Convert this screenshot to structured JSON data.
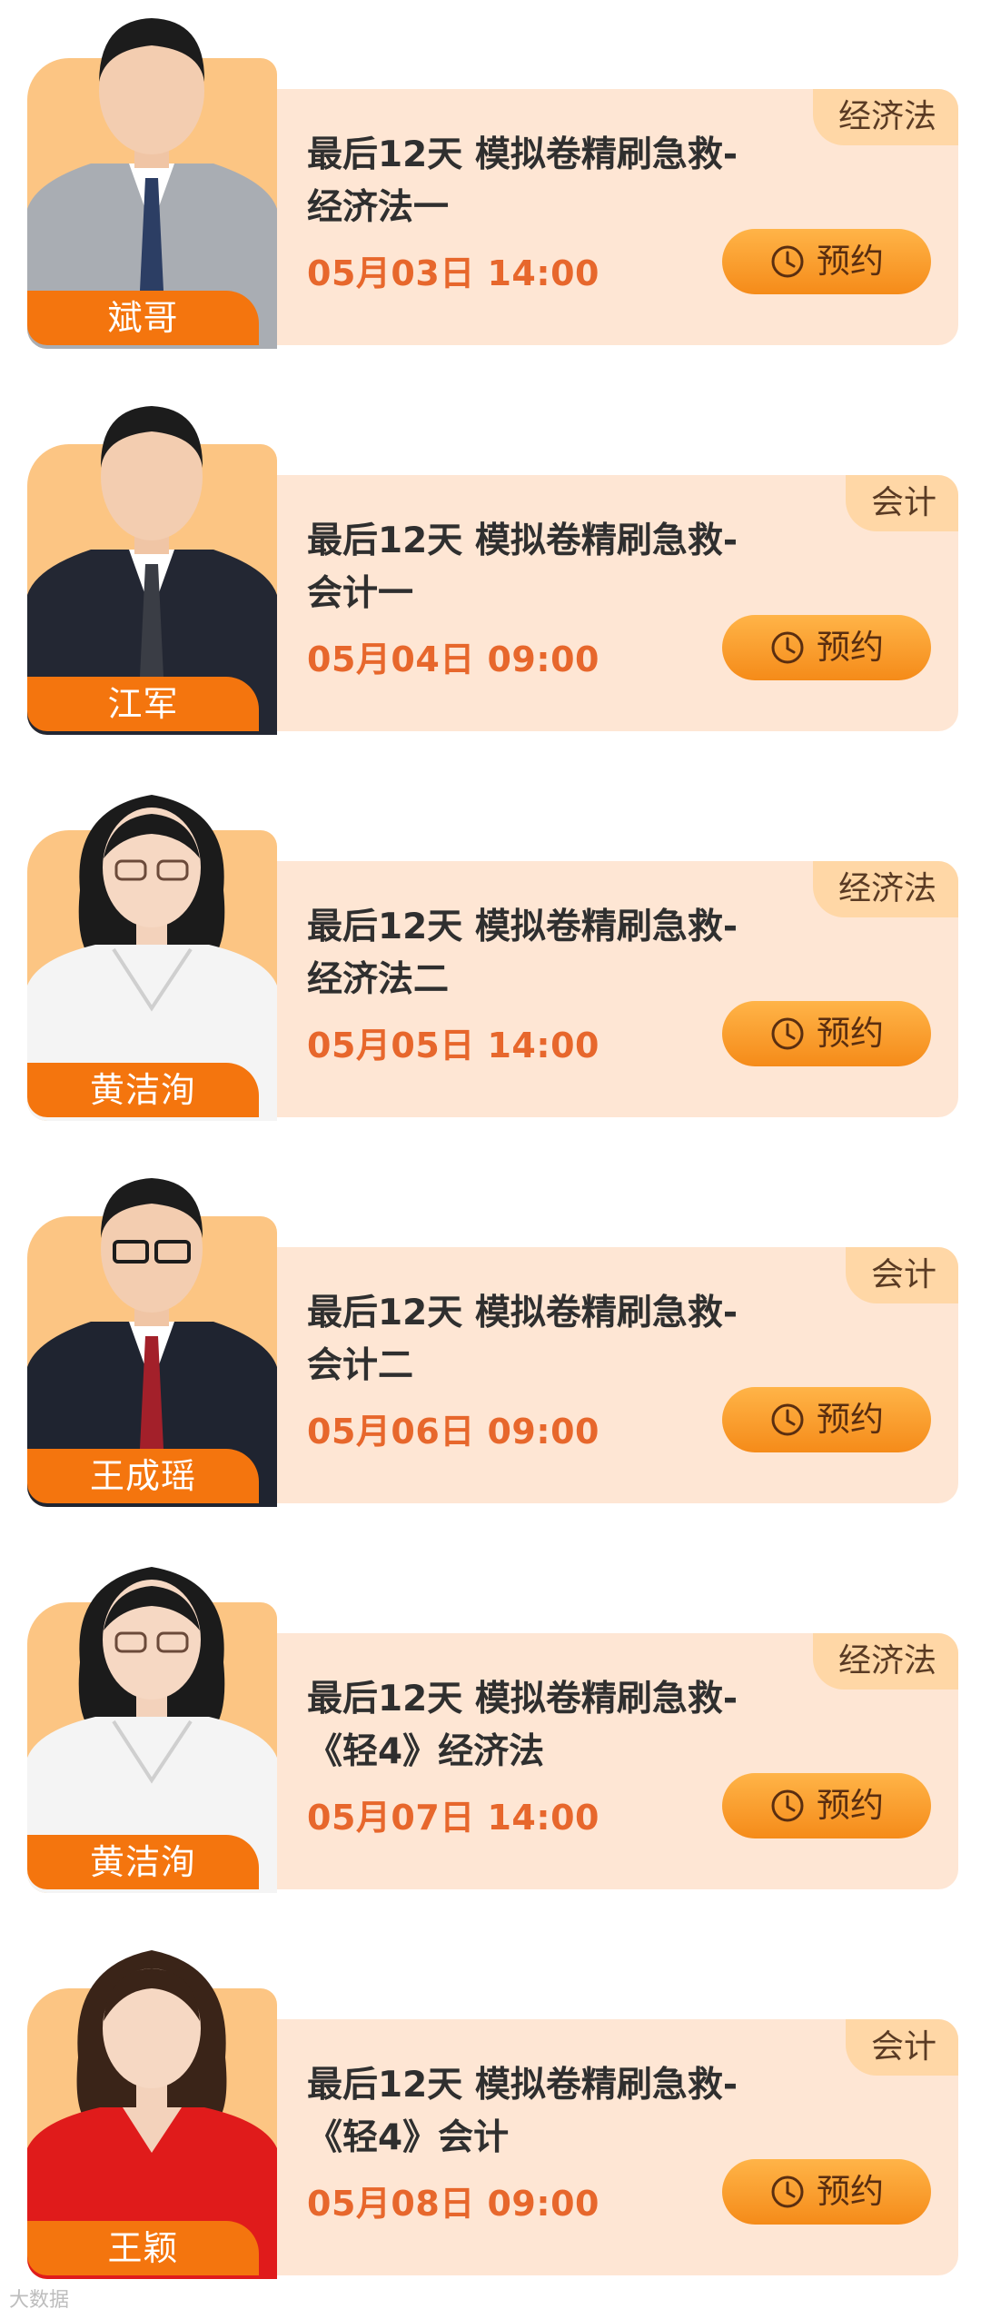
{
  "button_label": "预约",
  "cards": [
    {
      "teacher": "斌哥",
      "subject": "经济法",
      "title_line1": "最后12天 模拟卷精刷急救-",
      "title_line2": "经济法一",
      "datetime": "05月03日 14:00",
      "suit": "gray-suit"
    },
    {
      "teacher": "江军",
      "subject": "会计",
      "title_line1": "最后12天 模拟卷精刷急救-",
      "title_line2": "会计一",
      "datetime": "05月04日 09:00",
      "suit": "dark-suit"
    },
    {
      "teacher": "黄洁洵",
      "subject": "经济法",
      "title_line1": "最后12天 模拟卷精刷急救-",
      "title_line2": "经济法二",
      "datetime": "05月05日 14:00",
      "suit": "white-blouse"
    },
    {
      "teacher": "王成瑶",
      "subject": "会计",
      "title_line1": "最后12天 模拟卷精刷急救-",
      "title_line2": "会计二",
      "datetime": "05月06日 09:00",
      "suit": "dark-suit"
    },
    {
      "teacher": "黄洁洵",
      "subject": "经济法",
      "title_line1": "最后12天 模拟卷精刷急救-",
      "title_line2": "《轻4》经济法",
      "datetime": "05月07日 14:00",
      "suit": "white-blouse"
    },
    {
      "teacher": "王颖",
      "subject": "会计",
      "title_line1": "最后12天 模拟卷精刷急救-",
      "title_line2": "《轻4》会计",
      "datetime": "05月08日 09:00",
      "suit": "red-jacket"
    }
  ],
  "watermark": "大数据"
}
